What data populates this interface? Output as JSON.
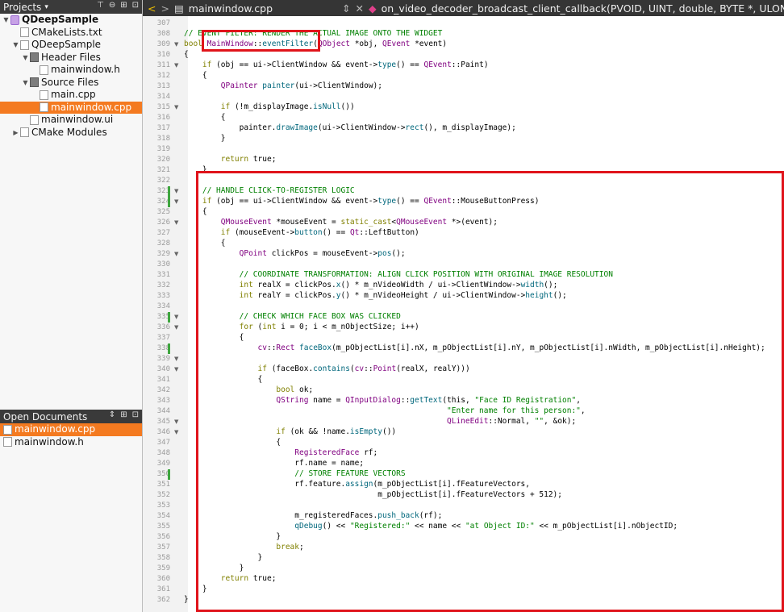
{
  "projects_panel": {
    "title": "Projects",
    "tree": [
      {
        "label": "QDeepSample",
        "depth": 0,
        "icon": "project-icon",
        "expanded": true,
        "bold": true
      },
      {
        "label": "CMakeLists.txt",
        "depth": 1,
        "icon": "cmake-file-icon"
      },
      {
        "label": "QDeepSample",
        "depth": 1,
        "icon": "target-icon",
        "expanded": true
      },
      {
        "label": "Header Files",
        "depth": 2,
        "icon": "folder-icon",
        "expanded": true
      },
      {
        "label": "mainwindow.h",
        "depth": 3,
        "icon": "header-file-icon"
      },
      {
        "label": "Source Files",
        "depth": 2,
        "icon": "folder-icon",
        "expanded": true
      },
      {
        "label": "main.cpp",
        "depth": 3,
        "icon": "cpp-file-icon"
      },
      {
        "label": "mainwindow.cpp",
        "depth": 3,
        "icon": "cpp-file-icon",
        "selected": true
      },
      {
        "label": "mainwindow.ui",
        "depth": 2,
        "icon": "ui-file-icon"
      },
      {
        "label": "CMake Modules",
        "depth": 1,
        "icon": "cmake-modules-icon",
        "collapsed": true
      }
    ]
  },
  "open_documents": {
    "title": "Open Documents",
    "items": [
      {
        "label": "mainwindow.cpp",
        "selected": true
      },
      {
        "label": "mainwindow.h"
      }
    ]
  },
  "editor_tabs": {
    "file": "mainwindow.cpp",
    "function": "on_video_decoder_broadcast_client_callback(PVOID, UINT, double, BYTE *, ULONG, PV"
  },
  "code": {
    "line_numbers": [
      "307",
      "308",
      "309",
      "310",
      "311",
      "312",
      "313",
      "314",
      "315",
      "316",
      "317",
      "318",
      "319",
      "320",
      "321",
      "322",
      "323",
      "324",
      "325",
      "326",
      "327",
      "328",
      "329",
      "330",
      "331",
      "332",
      "333",
      "334",
      "335",
      "336",
      "337",
      "338",
      "339",
      "340",
      "341",
      "342",
      "343",
      "344",
      "345",
      "346",
      "347",
      "348",
      "349",
      "350",
      "351",
      "352",
      "353",
      "354",
      "355",
      "356",
      "357",
      "358",
      "359",
      "360",
      "361",
      "362"
    ],
    "line_309": "bool MainWindow::eventFilter(QObject *obj, QEvent *event)",
    "line_308_top": "// E       LTER: RENDER THE ACTUAL IMAGE ONTO THE WIDGET",
    "lines": [
      "",
      "// EVENT FILTER: RENDER THE ACTUAL IMAGE ONTO THE WIDGET",
      "bool MainWindow::eventFilter(QObject *obj, QEvent *event)",
      "{",
      "    if (obj == ui->ClientWindow && event->type() == QEvent::Paint)",
      "    {",
      "        QPainter painter(ui->ClientWindow);",
      "",
      "        if (!m_displayImage.isNull())",
      "        {",
      "            painter.drawImage(ui->ClientWindow->rect(), m_displayImage);",
      "        }",
      "",
      "        return true;",
      "    }",
      "",
      "    // HANDLE CLICK-TO-REGISTER LOGIC",
      "    if (obj == ui->ClientWindow && event->type() == QEvent::MouseButtonPress)",
      "    {",
      "        QMouseEvent *mouseEvent = static_cast<QMouseEvent *>(event);",
      "        if (mouseEvent->button() == Qt::LeftButton)",
      "        {",
      "            QPoint clickPos = mouseEvent->pos();",
      "",
      "            // COORDINATE TRANSFORMATION: ALIGN CLICK POSITION WITH ORIGINAL IMAGE RESOLUTION",
      "            int realX = clickPos.x() * m_nVideoWidth / ui->ClientWindow->width();",
      "            int realY = clickPos.y() * m_nVideoHeight / ui->ClientWindow->height();",
      "",
      "            // CHECK WHICH FACE BOX WAS CLICKED",
      "            for (int i = 0; i < m_nObjectSize; i++)",
      "            {",
      "                cv::Rect faceBox(m_pObjectList[i].nX, m_pObjectList[i].nY, m_pObjectList[i].nWidth, m_pObjectList[i].nHeight);",
      "",
      "                if (faceBox.contains(cv::Point(realX, realY)))",
      "                {",
      "                    bool ok;",
      "                    QString name = QInputDialog::getText(this, \"Face ID Registration\",",
      "                                                         \"Enter name for this person:\",",
      "                                                         QLineEdit::Normal, \"\", &ok);",
      "                    if (ok && !name.isEmpty())",
      "                    {",
      "                        RegisteredFace rf;",
      "                        rf.name = name;",
      "                        // STORE FEATURE VECTORS",
      "                        rf.feature.assign(m_pObjectList[i].fFeatureVectors,",
      "                                          m_pObjectList[i].fFeatureVectors + 512);",
      "",
      "                        m_registeredFaces.push_back(rf);",
      "                        qDebug() << \"Registered:\" << name << \"at Object ID:\" << m_pObjectList[i].nObjectID;",
      "                    }",
      "                    break;",
      "                }",
      "            }",
      "        return true;",
      "    }",
      "}"
    ]
  }
}
